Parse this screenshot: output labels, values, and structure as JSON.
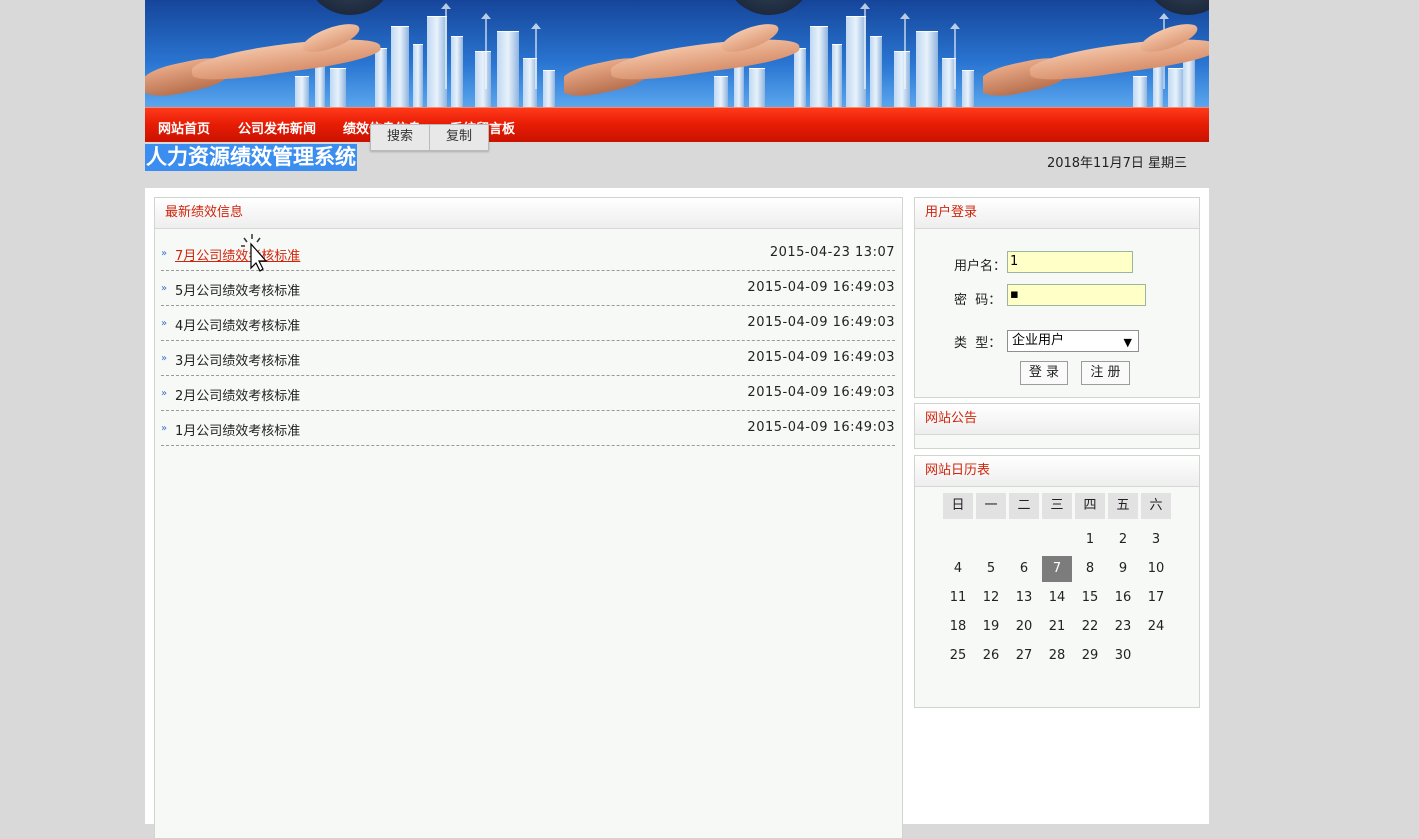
{
  "nav": {
    "items": [
      "网站首页",
      "公司发布新闻",
      "绩效信息信息",
      "系统留言板"
    ]
  },
  "popup": {
    "search": "搜索",
    "copy": "复制"
  },
  "header": {
    "title": "人力资源绩效管理系统",
    "date": "2018年11月7日 星期三"
  },
  "news": {
    "heading": "最新绩效信息",
    "items": [
      {
        "title": "7月公司绩效考核标准",
        "time": "2015-04-23 13:07"
      },
      {
        "title": "5月公司绩效考核标准",
        "time": "2015-04-09 16:49:03"
      },
      {
        "title": "4月公司绩效考核标准",
        "time": "2015-04-09 16:49:03"
      },
      {
        "title": "3月公司绩效考核标准",
        "time": "2015-04-09 16:49:03"
      },
      {
        "title": "2月公司绩效考核标准",
        "time": "2015-04-09 16:49:03"
      },
      {
        "title": "1月公司绩效考核标准",
        "time": "2015-04-09 16:49:03"
      }
    ]
  },
  "login": {
    "heading": "用户登录",
    "username_label": "用户名：",
    "username_value": "1",
    "password_label": "密  码：",
    "password_value": "▪",
    "type_label": "类  型：",
    "type_value": "企业用户",
    "login_button": "登 录",
    "register_button": "注 册"
  },
  "notice": {
    "heading": "网站公告"
  },
  "calendar": {
    "heading": "网站日历表",
    "weekdays": [
      "日",
      "一",
      "二",
      "三",
      "四",
      "五",
      "六"
    ],
    "weeks": [
      [
        "",
        "",
        "",
        "",
        "1",
        "2",
        "3"
      ],
      [
        "4",
        "5",
        "6",
        "7",
        "8",
        "9",
        "10"
      ],
      [
        "11",
        "12",
        "13",
        "14",
        "15",
        "16",
        "17"
      ],
      [
        "18",
        "19",
        "20",
        "21",
        "22",
        "23",
        "24"
      ],
      [
        "25",
        "26",
        "27",
        "28",
        "29",
        "30",
        ""
      ]
    ],
    "today": "7"
  },
  "colors": {
    "nav_red": "#e81d05",
    "heading_red": "#d0250c",
    "title_highlight": "#3b8ef0"
  }
}
